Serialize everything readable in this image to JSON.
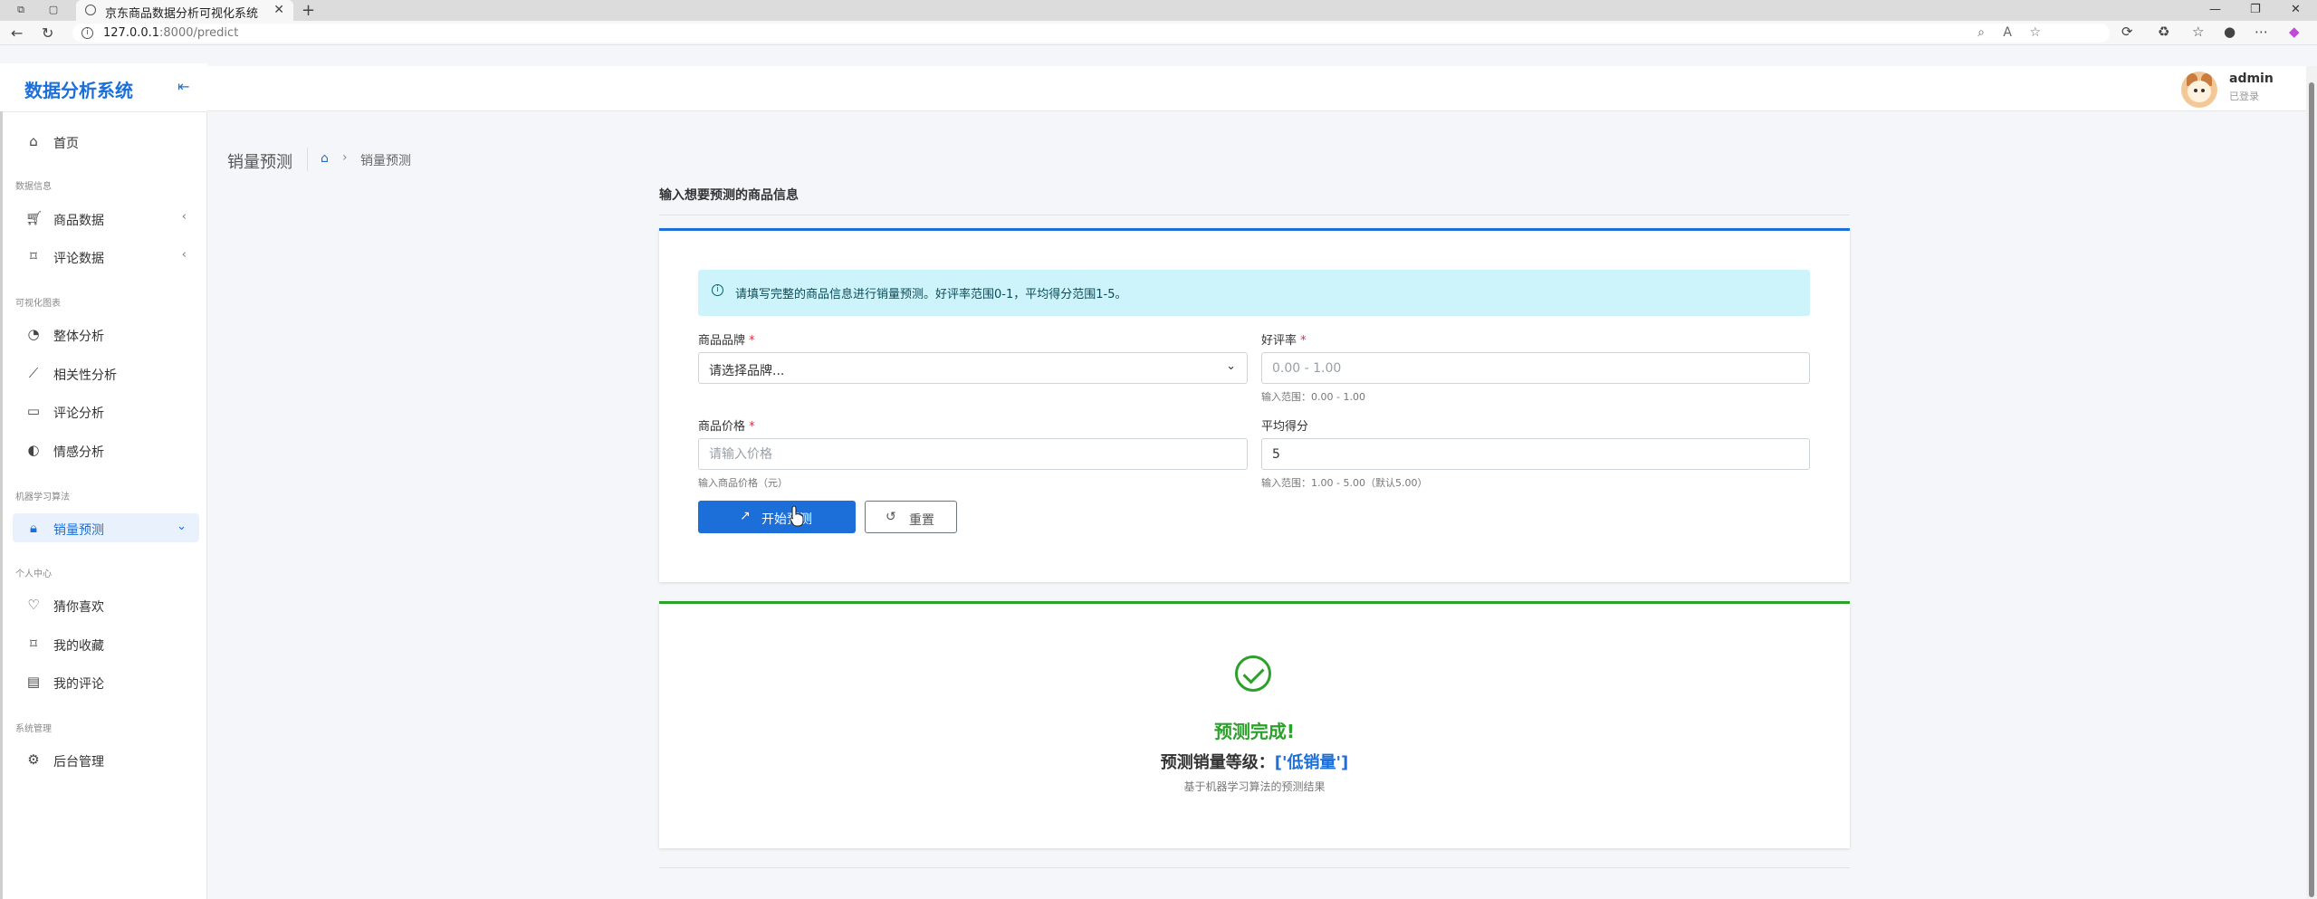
{
  "browser": {
    "tab_title": "京东商品数据分析可视化系统",
    "url_host": "127.0.0.1",
    "url_rest": ":8000/predict"
  },
  "app": {
    "brand": "数据分析系统",
    "user": {
      "name": "admin",
      "status": "已登录"
    }
  },
  "sidebar": {
    "home": "首页",
    "sections": {
      "data_info": "数据信息",
      "charts": "可视化图表",
      "ml": "机器学习算法",
      "personal": "个人中心",
      "system": "系统管理"
    },
    "items": {
      "product_data": "商品数据",
      "review_data": "评论数据",
      "overall": "整体分析",
      "correlation": "相关性分析",
      "review_analysis": "评论分析",
      "sentiment": "情感分析",
      "sales_predict": "销量预测",
      "guess_like": "猜你喜欢",
      "favorites": "我的收藏",
      "my_reviews": "我的评论",
      "admin": "后台管理"
    }
  },
  "page": {
    "title": "销量预测",
    "breadcrumb_current": "销量预测",
    "form_heading": "输入想要预测的商品信息"
  },
  "form": {
    "alert": "请填写完整的商品信息进行销量预测。好评率范围0-1，平均得分范围1-5。",
    "brand_label": "商品品牌",
    "brand_placeholder": "请选择品牌...",
    "rating_label": "好评率",
    "rating_placeholder": "0.00 - 1.00",
    "rating_hint": "输入范围：0.00 - 1.00",
    "price_label": "商品价格",
    "price_placeholder": "请输入价格",
    "price_hint": "输入商品价格（元）",
    "score_label": "平均得分",
    "score_value": "5",
    "score_hint": "输入范围：1.00 - 5.00（默认5.00）",
    "required_mark": "*",
    "submit_label": "开始预测",
    "reset_label": "重置"
  },
  "result": {
    "title": "预测完成!",
    "level_label": "预测销量等级：",
    "level_value": "['低销量']",
    "note": "基于机器学习算法的预测结果"
  },
  "colors": {
    "primary": "#1c6fd8",
    "success": "#2ba02b",
    "alert_bg": "#cef4fb",
    "required": "#d9303c"
  }
}
